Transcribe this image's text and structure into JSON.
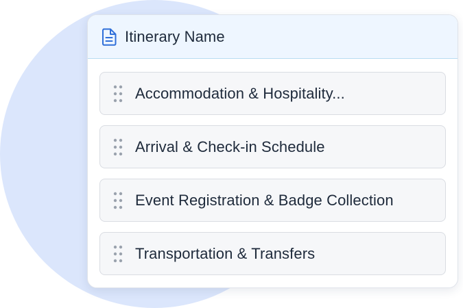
{
  "colors": {
    "background_circle": "#dbe6fc",
    "header_background": "#eef6ff",
    "header_border": "#b9dcf2",
    "icon_accent": "#2f6fd9",
    "text": "#1e2a3b",
    "item_background": "#f6f7f9",
    "item_border": "#d9dce2",
    "grip": "#9aa2ad"
  },
  "card": {
    "header_icon": "document-icon",
    "title": "Itinerary Name"
  },
  "items": [
    {
      "label": "Accommodation & Hospitality...",
      "icon": "drag-handle-icon"
    },
    {
      "label": "Arrival & Check-in Schedule",
      "icon": "drag-handle-icon"
    },
    {
      "label": "Event Registration & Badge Collection",
      "icon": "drag-handle-icon"
    },
    {
      "label": "Transportation & Transfers",
      "icon": "drag-handle-icon"
    }
  ]
}
